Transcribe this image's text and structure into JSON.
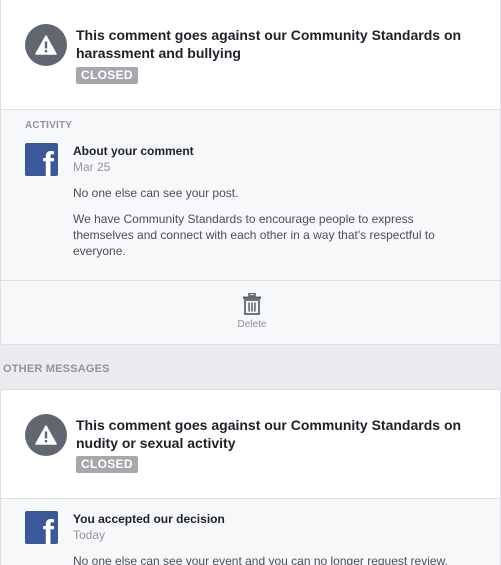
{
  "card1": {
    "icon": "warning-icon",
    "title": "This comment goes against our Community Standards on harassment and bullying",
    "status": "CLOSED",
    "activity_label": "ACTIVITY",
    "message": {
      "icon": "facebook-logo",
      "title": "About your comment",
      "date": "Mar 25",
      "paragraphs": [
        "No one else can see your post.",
        "We have Community Standards to encourage people to express themselves and connect with each other in a way that's respectful to everyone."
      ]
    },
    "delete_label": "Delete",
    "delete_icon": "trash-icon"
  },
  "other_messages_label": "OTHER MESSAGES",
  "card2": {
    "icon": "warning-icon",
    "title": "This comment goes against our Community Standards on nudity or sexual activity",
    "status": "CLOSED",
    "message": {
      "icon": "facebook-logo",
      "title": "You accepted our decision",
      "date": "Today",
      "paragraphs": [
        "No one else can see your event and you can no longer request review."
      ]
    }
  },
  "colors": {
    "background": "#e9ebee",
    "badge": "#a5a8ad",
    "facebook_blue": "#3b5998",
    "warning_circle": "#606770",
    "secondary_text": "#90949c"
  }
}
